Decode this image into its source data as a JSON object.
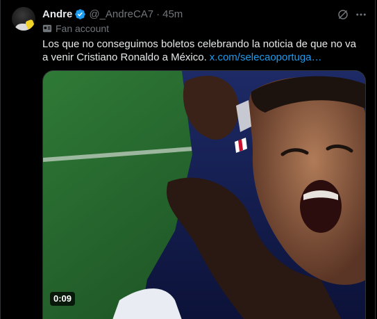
{
  "tweet": {
    "author_name": "Andre",
    "author_handle": "@_AndreCA7",
    "separator": "·",
    "timestamp": "45m",
    "account_label": "Fan account",
    "text": "Los que no conseguimos boletos celebrando la noticia de que no va a venir Cristiano Ronaldo a México.",
    "link_text": "x.com/selecaoportuga…",
    "video_duration": "0:09"
  },
  "icons": {
    "verified": "verified-badge-icon",
    "grok": "grok-icon",
    "more": "more-icon",
    "label": "fan-account-label-icon"
  },
  "colors": {
    "background": "#000000",
    "text_primary": "#e7e9ea",
    "text_secondary": "#71767b",
    "link": "#1d9bf0",
    "verified": "#1d9bf0",
    "border": "#2f3336"
  }
}
